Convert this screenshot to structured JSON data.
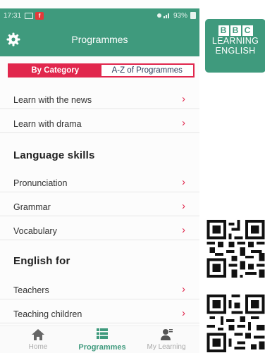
{
  "status_bar": {
    "time": "17:31",
    "battery": "93%"
  },
  "app_bar": {
    "title": "Programmes",
    "settings_icon": "gear-icon"
  },
  "tabs": [
    {
      "label": "By Category",
      "active": true
    },
    {
      "label": "A-Z of Programmes",
      "active": false
    }
  ],
  "list": {
    "top_items": [
      {
        "label": "Learn with the news"
      },
      {
        "label": "Learn with drama"
      }
    ],
    "sections": [
      {
        "heading": "Language skills",
        "items": [
          {
            "label": "Pronunciation"
          },
          {
            "label": "Grammar"
          },
          {
            "label": "Vocabulary"
          }
        ]
      },
      {
        "heading": "English for",
        "items": [
          {
            "label": "Teachers"
          },
          {
            "label": "Teaching children"
          }
        ]
      }
    ],
    "chevron": "›"
  },
  "bottom_nav": [
    {
      "label": "Home",
      "icon": "home-icon",
      "active": false
    },
    {
      "label": "Programmes",
      "icon": "list-icon",
      "active": true
    },
    {
      "label": "My Learning",
      "icon": "person-icon",
      "active": false
    }
  ],
  "brand": {
    "blocks": [
      "B",
      "B",
      "C"
    ],
    "line1": "LEARNING",
    "line2": "ENGLISH"
  },
  "colors": {
    "accent": "#3f9a7d",
    "tab_red": "#e1274d",
    "text": "#333333"
  }
}
